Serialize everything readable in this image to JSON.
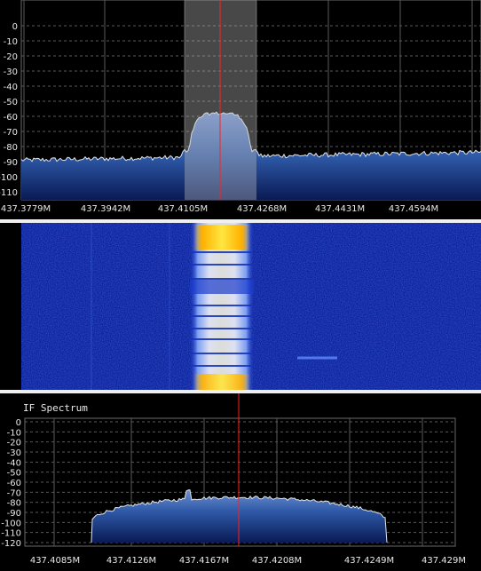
{
  "main_spectrum": {
    "y_ticks": [
      "0",
      "-10",
      "-20",
      "-30",
      "-40",
      "-50",
      "-60",
      "-70",
      "-80",
      "-90",
      "-100",
      "-110"
    ],
    "y_values": [
      0,
      -10,
      -20,
      -30,
      -40,
      -50,
      -60,
      -70,
      -80,
      -90,
      -100,
      -110
    ],
    "x_ticks": [
      "437.3779M",
      "437.3942M",
      "437.4105M",
      "437.4268M",
      "437.4431M",
      "437.4594M"
    ],
    "x_values_mhz": [
      437.3779,
      437.3942,
      437.4105,
      437.4268,
      437.4431,
      437.4594
    ],
    "noise_floor_db": -89,
    "signal_peak_db": -58,
    "colors": {
      "line": "#e6e6e6",
      "fill_top": "#2f5aa8",
      "fill_bottom": "#0a1a55",
      "marker": "#ff2020",
      "filter_band": "#b8b8b8"
    }
  },
  "waterfall": {
    "colors": {
      "background": "#0c1fa0",
      "signal_core": "#fff4a0",
      "signal_edge": "#ffffff"
    }
  },
  "if_spectrum": {
    "title": "IF Spectrum",
    "y_ticks": [
      "0",
      "-10",
      "-20",
      "-30",
      "-40",
      "-50",
      "-60",
      "-70",
      "-80",
      "-90",
      "-100",
      "-110",
      "-120"
    ],
    "y_values": [
      0,
      -10,
      -20,
      -30,
      -40,
      -50,
      -60,
      -70,
      -80,
      -90,
      -100,
      -110,
      -120
    ],
    "x_ticks": [
      "437.4085M",
      "437.4126M",
      "437.4167M",
      "437.4208M",
      "437.4249M",
      "437.429M"
    ],
    "x_values_mhz": [
      437.4085,
      437.4126,
      437.4167,
      437.4208,
      437.4249,
      437.429
    ],
    "signal_level_db": -75,
    "colors": {
      "line": "#e6e6e6",
      "fill_top": "#2f5aa8",
      "fill_bottom": "#0a1a55",
      "marker": "#ff2020"
    }
  }
}
